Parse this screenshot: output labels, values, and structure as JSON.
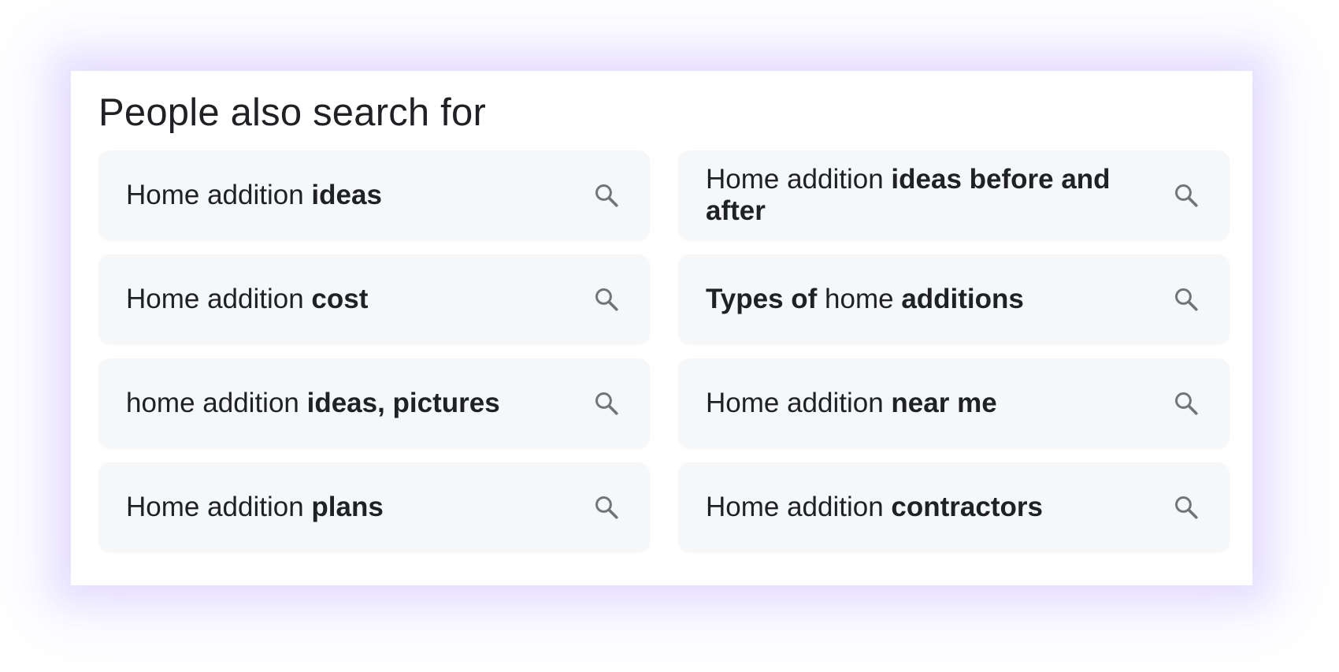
{
  "section": {
    "title": "People also search for"
  },
  "suggestions": [
    {
      "normal1": "Home addition ",
      "bold1": "ideas",
      "normal2": "",
      "bold2": ""
    },
    {
      "normal1": "Home addition ",
      "bold1": "ideas before and after",
      "normal2": "",
      "bold2": ""
    },
    {
      "normal1": "Home addition ",
      "bold1": "cost",
      "normal2": "",
      "bold2": ""
    },
    {
      "normal1": "",
      "bold1": "Types of",
      "normal2": " home ",
      "bold2": "additions"
    },
    {
      "normal1": "home addition ",
      "bold1": "ideas, pictures",
      "normal2": "",
      "bold2": ""
    },
    {
      "normal1": "Home addition ",
      "bold1": "near me",
      "normal2": "",
      "bold2": ""
    },
    {
      "normal1": "Home addition ",
      "bold1": "plans",
      "normal2": "",
      "bold2": ""
    },
    {
      "normal1": "Home addition ",
      "bold1": "contractors",
      "normal2": "",
      "bold2": ""
    }
  ],
  "icons": {
    "suggestion_icon": "search-icon"
  },
  "colors": {
    "text": "#202124",
    "chip_background": "#f6f7f9",
    "icon": "#70757a",
    "glow": "#c8baff"
  }
}
